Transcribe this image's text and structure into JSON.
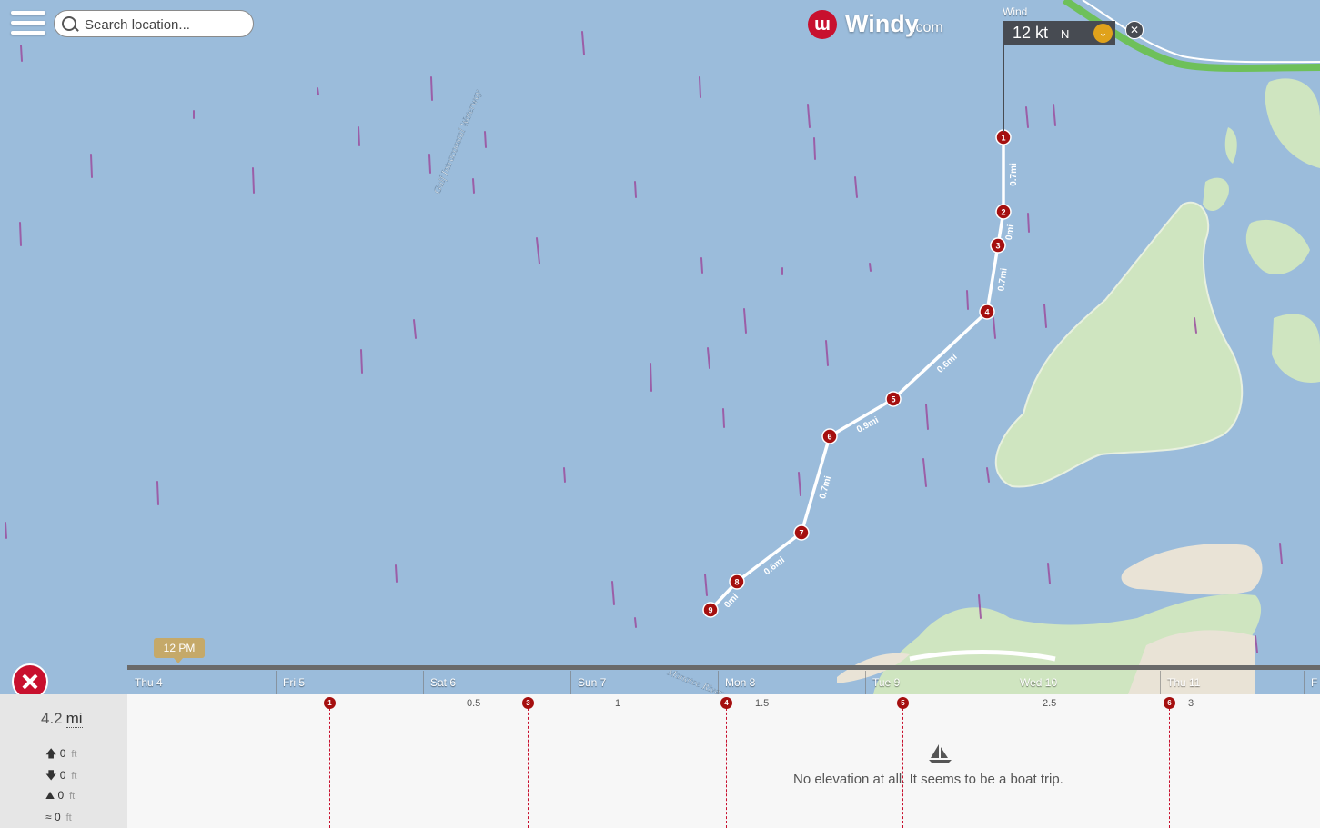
{
  "header": {
    "search_placeholder": "Search location...",
    "brand_word": "Windy",
    "brand_domain": ".com",
    "brand_icon": "windy-logo-icon"
  },
  "wind_popup": {
    "label": "Wind",
    "value": "12 kt",
    "direction": "N",
    "dropdown_icon": "chevron-down-icon",
    "close_icon": "close-icon"
  },
  "map": {
    "labels": [
      "Gulf Intracoastal Waterway",
      "Manatee River"
    ],
    "colors": {
      "water": "#9bbcdb",
      "land": "#cfe5c0",
      "route": "#ffffff",
      "waypoint": "#a50f0f"
    },
    "route_waypoints": [
      "1",
      "2",
      "3",
      "4",
      "5",
      "6",
      "7",
      "8",
      "9"
    ],
    "segment_labels": [
      "0.7mi",
      "0mi",
      "0.7mi",
      "0.6mi",
      "0.9mi",
      "0.7mi",
      "0.6mi",
      "0mi"
    ]
  },
  "timeline": {
    "current_time": "12 PM",
    "days": [
      "Thu 4",
      "Fri 5",
      "Sat 6",
      "Sun 7",
      "Mon 8",
      "Tue 9",
      "Wed 10",
      "Thu 11",
      "F"
    ]
  },
  "route_panel": {
    "distance": "4.2",
    "distance_unit": "mi",
    "stats": [
      {
        "icon": "ascent-icon",
        "value": "0",
        "unit": "ft"
      },
      {
        "icon": "descent-icon",
        "value": "0",
        "unit": "ft"
      },
      {
        "icon": "max-elevation-icon",
        "value": "0",
        "unit": "ft"
      },
      {
        "icon": "waves-icon",
        "value": "0",
        "unit": "ft"
      }
    ],
    "waypoint_markers": [
      "1",
      "3",
      "4",
      "5",
      "6"
    ],
    "distance_ticks": [
      "0.5",
      "1",
      "1.5",
      "2.5",
      "3"
    ],
    "message": "No elevation at all. It seems to be a boat trip.",
    "message_icon": "sailboat-icon"
  }
}
